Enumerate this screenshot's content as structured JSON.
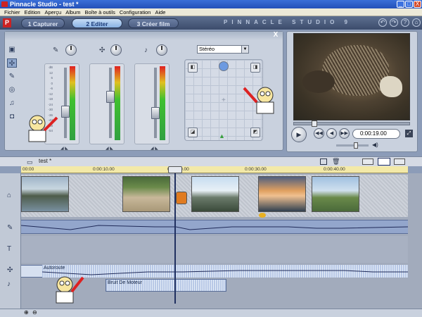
{
  "window": {
    "title": "Pinnacle Studio - test *",
    "min": "_",
    "max": "□",
    "close": "X"
  },
  "menu": [
    "Fichier",
    "Edition",
    "Aperçu",
    "Album",
    "Boîte à outils",
    "Configuration",
    "Aide"
  ],
  "tabs": [
    {
      "label": "1 Capturer"
    },
    {
      "label": "2 Editer"
    },
    {
      "label": "3 Créer film"
    }
  ],
  "brand": "PINNACLE STUDIO 9",
  "header_icons": {
    "undo": "↶",
    "redo": "↷",
    "help": "?",
    "home": "⌂"
  },
  "toolbox": {
    "close": "X",
    "stereo_value": "Stéréo",
    "scale": [
      "dB",
      "12",
      "6",
      "0",
      "-6",
      "-12",
      "-18",
      "-24",
      "-30",
      "-36",
      "-42",
      "-48",
      "-54"
    ],
    "channels": [
      {
        "name": "video-audio",
        "level": 0.35
      },
      {
        "name": "sound-effects",
        "level": 0.6
      },
      {
        "name": "music",
        "level": 0.33
      }
    ],
    "tools": [
      {
        "name": "video-toolbox-icon",
        "glyph": "▣"
      },
      {
        "name": "audio-mixer-icon",
        "glyph": "✣"
      },
      {
        "name": "voiceover-icon",
        "glyph": "✎"
      },
      {
        "name": "cd-audio-icon",
        "glyph": "◎"
      },
      {
        "name": "music-icon",
        "glyph": "♫"
      },
      {
        "name": "sound-effects-icon",
        "glyph": "◘"
      }
    ]
  },
  "player": {
    "timecode": "0:00:19.00",
    "play": "▶",
    "rewind": "◀◀",
    "back": "◀",
    "fwd": "▶",
    "ffwd": "▶▶"
  },
  "timeline": {
    "project_name": "test *",
    "ticks": [
      "00:00",
      "0:00:10.00",
      "0:00:20.00",
      "0:00:30.00",
      "0:00:40.00"
    ],
    "music_clip": "Autoroute",
    "sfx_clip": "Bruit De Moteur",
    "colors": {
      "ruler": "#f3e9a8",
      "audio": "#93a6cc",
      "active_tab": "#8ab2e4"
    }
  }
}
